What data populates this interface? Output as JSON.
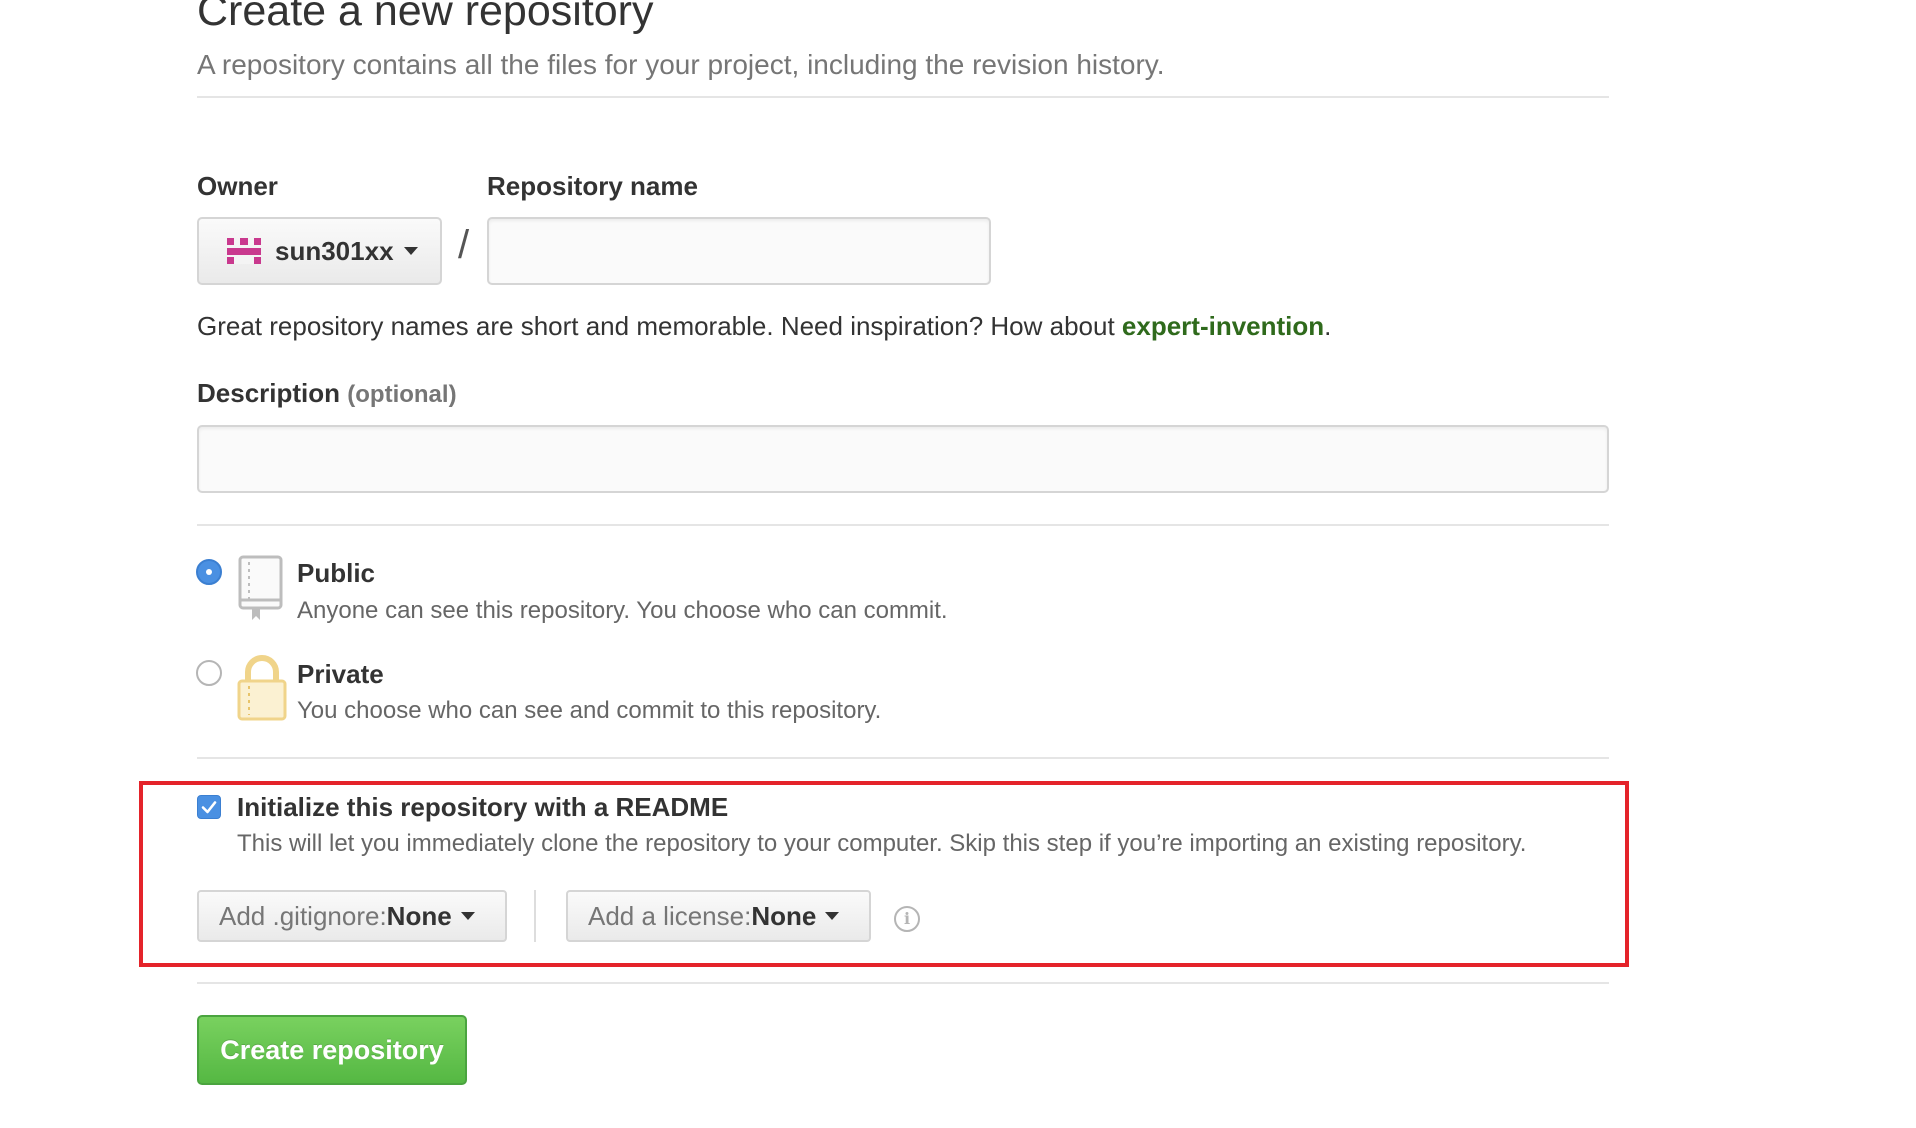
{
  "header": {
    "title": "Create a new repository",
    "subtitle": "A repository contains all the files for your project, including the revision history."
  },
  "owner": {
    "label": "Owner",
    "selected": "sun301xx",
    "avatar": "identicon-avatar"
  },
  "repository": {
    "label": "Repository name",
    "separator": "/",
    "value": "",
    "placeholder": ""
  },
  "hint": {
    "text": "Great repository names are short and memorable. Need inspiration? How about ",
    "suggestion": "expert-invention",
    "suffix": "."
  },
  "description": {
    "label": "Description",
    "optional": "(optional)",
    "value": "",
    "placeholder": ""
  },
  "visibility": {
    "selected": "Public",
    "public": {
      "title": "Public",
      "desc": "Anyone can see this repository. You choose who can commit.",
      "icon": "repo-book-icon"
    },
    "private": {
      "title": "Private",
      "desc": "You choose who can see and commit to this repository.",
      "icon": "lock-icon"
    }
  },
  "readme": {
    "checked": true,
    "title": "Initialize this repository with a README",
    "desc": "This will let you immediately clone the repository to your computer. Skip this step if you’re importing an existing repository."
  },
  "gitignore": {
    "prefix": "Add .gitignore: ",
    "value": "None"
  },
  "license": {
    "prefix": "Add a license: ",
    "value": "None"
  },
  "info_icon": "info-icon",
  "submit": {
    "label": "Create repository"
  },
  "colors": {
    "accent_blue": "#4a90e2",
    "link_green": "#2f6a1c",
    "button_green": "#55b843",
    "highlight_red": "#e4232a",
    "lock_gold": "#f0d48a"
  }
}
